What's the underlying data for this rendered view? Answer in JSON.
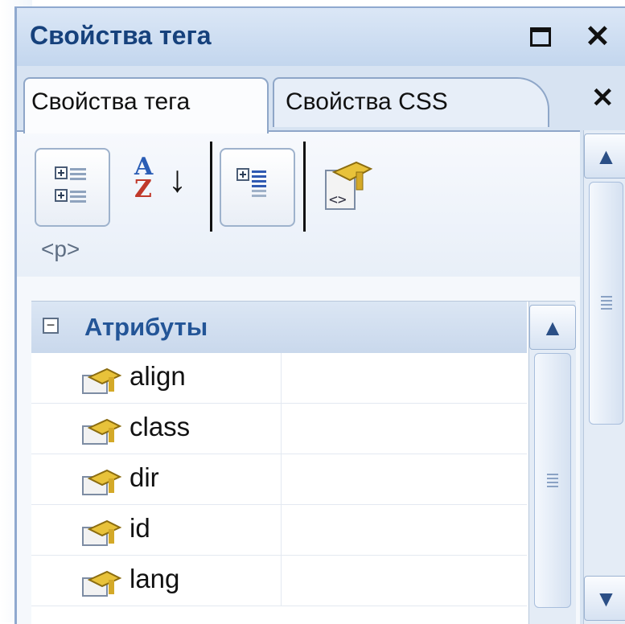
{
  "window": {
    "title": "Свойства тега"
  },
  "tabs": [
    {
      "label": "Свойства тега",
      "active": true
    },
    {
      "label": "Свойства CSS",
      "active": false
    }
  ],
  "toolbar": {
    "current_tag": "<p>"
  },
  "grid": {
    "category": "Атрибуты",
    "rows": [
      {
        "name": "align",
        "value": ""
      },
      {
        "name": "class",
        "value": ""
      },
      {
        "name": "dir",
        "value": ""
      },
      {
        "name": "id",
        "value": ""
      },
      {
        "name": "lang",
        "value": ""
      }
    ]
  },
  "icons": {
    "maximize": "maximize-icon",
    "close": "close-icon",
    "categorized": "categorized-view-icon",
    "alphabetical": "sort-alphabetical-icon",
    "show_set": "show-set-properties-icon",
    "tag_props": "tag-properties-icon"
  },
  "colors": {
    "title": "#16417c",
    "category": "#235597",
    "panel": "#d9e5f3"
  }
}
